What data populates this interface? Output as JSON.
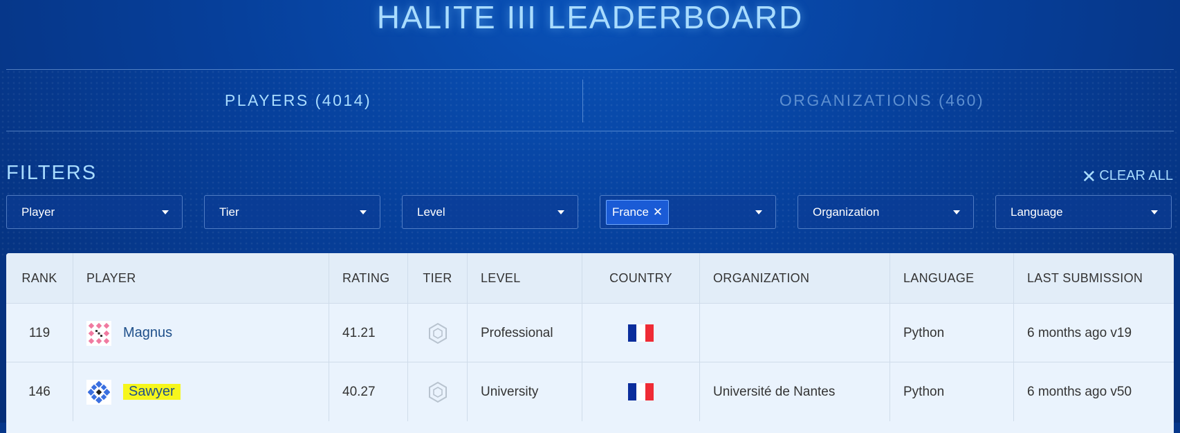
{
  "page": {
    "title": "HALITE III LEADERBOARD"
  },
  "tabs": [
    {
      "label": "PLAYERS (4014)",
      "active": true
    },
    {
      "label": "ORGANIZATIONS (460)",
      "active": false
    }
  ],
  "filters": {
    "title": "FILTERS",
    "clear_all": "CLEAR ALL",
    "player": "Player",
    "tier": "Tier",
    "level": "Level",
    "country_chip": "France",
    "organization": "Organization",
    "language": "Language"
  },
  "table": {
    "columns": [
      "RANK",
      "PLAYER",
      "RATING",
      "TIER",
      "LEVEL",
      "COUNTRY",
      "ORGANIZATION",
      "LANGUAGE",
      "LAST SUBMISSION"
    ],
    "rows": [
      {
        "rank": "119",
        "player": "Magnus",
        "rating": "41.21",
        "tier_icon": "tier-badge-icon",
        "level": "Professional",
        "country_icon": "france-flag-icon",
        "organization": "",
        "language": "Python",
        "last_submission": "6 months ago v19"
      },
      {
        "rank": "146",
        "player": "Sawyer",
        "rating": "40.27",
        "tier_icon": "tier-badge-icon",
        "level": "University",
        "country_icon": "france-flag-icon",
        "organization": "Université de Nantes",
        "language": "Python",
        "last_submission": "6 months ago v50"
      }
    ]
  },
  "colors": {
    "background": "#063f9a",
    "accent_text": "#a9dcff",
    "inactive_tab": "#5d8fd0",
    "chip": "#1a5bd6",
    "highlight": "#f6f61c",
    "flag_blue": "#0b2d9c",
    "flag_red": "#ef2b35"
  }
}
